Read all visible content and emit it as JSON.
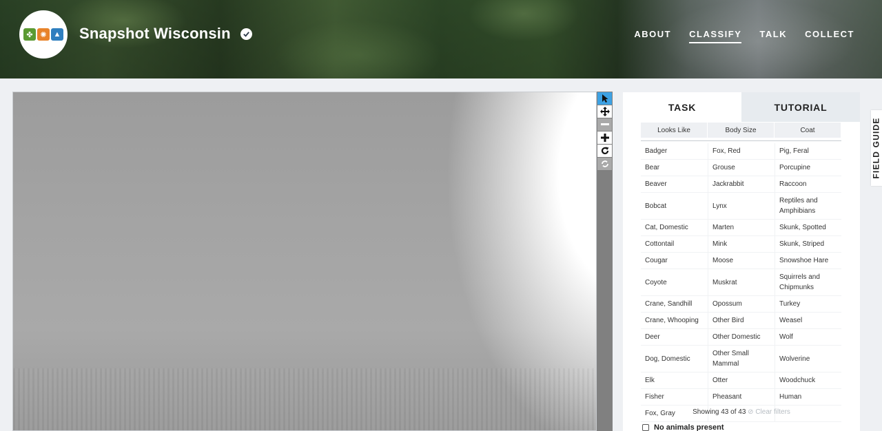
{
  "header": {
    "project_title": "Snapshot Wisconsin",
    "nav": [
      "ABOUT",
      "CLASSIFY",
      "TALK",
      "COLLECT"
    ],
    "active_nav": "CLASSIFY"
  },
  "panel": {
    "tabs": [
      "TASK",
      "TUTORIAL"
    ],
    "filters": [
      "Looks Like",
      "Body Size",
      "Coat"
    ],
    "choices_rows": [
      [
        "Badger",
        "Fox, Red",
        "Pig, Feral"
      ],
      [
        "Bear",
        "Grouse",
        "Porcupine"
      ],
      [
        "Beaver",
        "Jackrabbit",
        "Raccoon"
      ],
      [
        "Bobcat",
        "Lynx",
        "Reptiles and Amphibians"
      ],
      [
        "Cat, Domestic",
        "Marten",
        "Skunk, Spotted"
      ],
      [
        "Cottontail",
        "Mink",
        "Skunk, Striped"
      ],
      [
        "Cougar",
        "Moose",
        "Snowshoe Hare"
      ],
      [
        "Coyote",
        "Muskrat",
        "Squirrels and Chipmunks"
      ],
      [
        "Crane, Sandhill",
        "Opossum",
        "Turkey"
      ],
      [
        "Crane, Whooping",
        "Other Bird",
        "Weasel"
      ],
      [
        "Deer",
        "Other Domestic",
        "Wolf"
      ],
      [
        "Dog, Domestic",
        "Other Small Mammal",
        "Wolverine"
      ],
      [
        "Elk",
        "Otter",
        "Woodchuck"
      ],
      [
        "Fisher",
        "Pheasant",
        "Human"
      ],
      [
        "Fox, Gray",
        "",
        ""
      ]
    ],
    "showing_text": "Showing 43 of 43",
    "clear_filters": "Clear filters",
    "no_animals_label": "No animals present"
  },
  "field_guide_label": "FIELD GUIDE",
  "colors": {
    "active_tool": "#3da1e3",
    "toolbar_bg": "#808080",
    "panel_bg": "#ffffff",
    "inactive_tab_bg": "#e7ebef"
  },
  "icons": [
    "logo-leaf-icon",
    "logo-sun-icon",
    "logo-animal-icon",
    "verified-icon",
    "pointer-icon",
    "move-icon",
    "zoom-out-icon",
    "zoom-in-icon",
    "rotate-icon",
    "reset-icon",
    "clear-filter-icon"
  ]
}
